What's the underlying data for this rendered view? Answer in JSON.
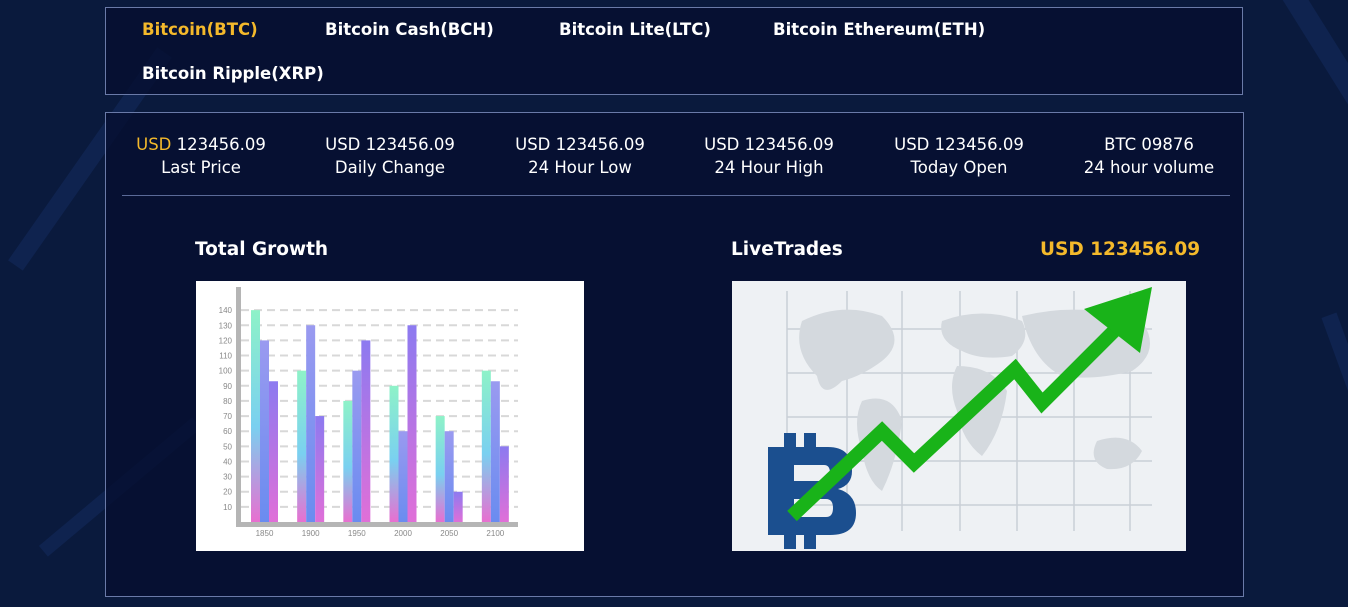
{
  "tabs": [
    {
      "label": "Bitcoin(BTC)",
      "active": true
    },
    {
      "label": "Bitcoin Cash(BCH)",
      "active": false
    },
    {
      "label": "Bitcoin Lite(LTC)",
      "active": false
    },
    {
      "label": "Bitcoin Ethereum(ETH)",
      "active": false
    },
    {
      "label": "Bitcoin Ripple(XRP)",
      "active": false
    }
  ],
  "stats": [
    {
      "currency": "USD",
      "value": "123456.09",
      "label": "Last Price"
    },
    {
      "currency": "USD",
      "value": "123456.09",
      "label": "Daily Change"
    },
    {
      "currency": "USD",
      "value": "123456.09",
      "label": "24 Hour Low"
    },
    {
      "currency": "USD",
      "value": "123456.09",
      "label": "24 Hour High"
    },
    {
      "currency": "USD",
      "value": "123456.09",
      "label": "Today Open"
    },
    {
      "currency": "BTC",
      "value": "09876",
      "label": "24 hour volume"
    }
  ],
  "growth": {
    "title": "Total Growth"
  },
  "live": {
    "title": "LiveTrades",
    "price": "USD 123456.09"
  },
  "colors": {
    "accent": "#f4b92b",
    "background": "#0a1a3d",
    "border": "#6a7aa8",
    "arrow": "#19b319",
    "bitcoin": "#1b4f8f"
  },
  "chart_data": {
    "type": "bar",
    "categories": [
      "1850",
      "1900",
      "1950",
      "2000",
      "2050",
      "2100"
    ],
    "series": [
      {
        "values": [
          140,
          100,
          80,
          90,
          70,
          100
        ]
      },
      {
        "values": [
          120,
          130,
          100,
          60,
          60,
          93
        ]
      },
      {
        "values": [
          93,
          70,
          120,
          130,
          20,
          50
        ]
      }
    ],
    "yticks": [
      10,
      20,
      30,
      40,
      50,
      60,
      70,
      80,
      90,
      100,
      110,
      120,
      130,
      140
    ],
    "ylim": [
      0,
      150
    ],
    "grid": true
  }
}
